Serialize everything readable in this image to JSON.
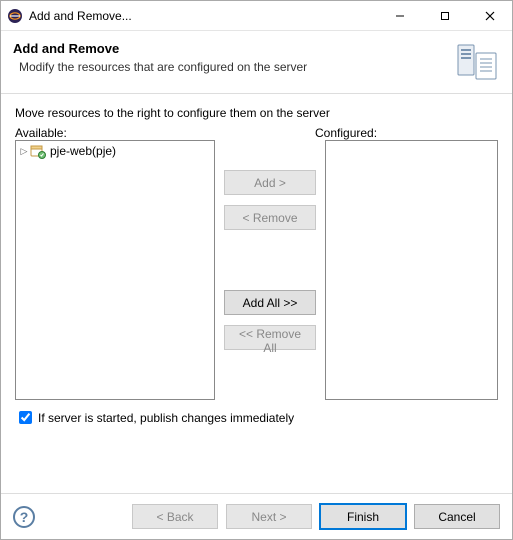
{
  "window": {
    "title": "Add and Remove..."
  },
  "header": {
    "title": "Add and Remove",
    "subtitle": "Modify the resources that are configured on the server"
  },
  "content": {
    "instruction": "Move resources to the right to configure them on the server",
    "available_label": "Available:",
    "configured_label": "Configured:",
    "available_items": [
      {
        "label": "pje-web(pje)"
      }
    ]
  },
  "buttons": {
    "add": "Add >",
    "remove": "< Remove",
    "add_all": "Add All >>",
    "remove_all": "<< Remove All",
    "back": "< Back",
    "next": "Next >",
    "finish": "Finish",
    "cancel": "Cancel"
  },
  "checkbox": {
    "publish_label": "If server is started, publish changes immediately",
    "checked": true
  }
}
